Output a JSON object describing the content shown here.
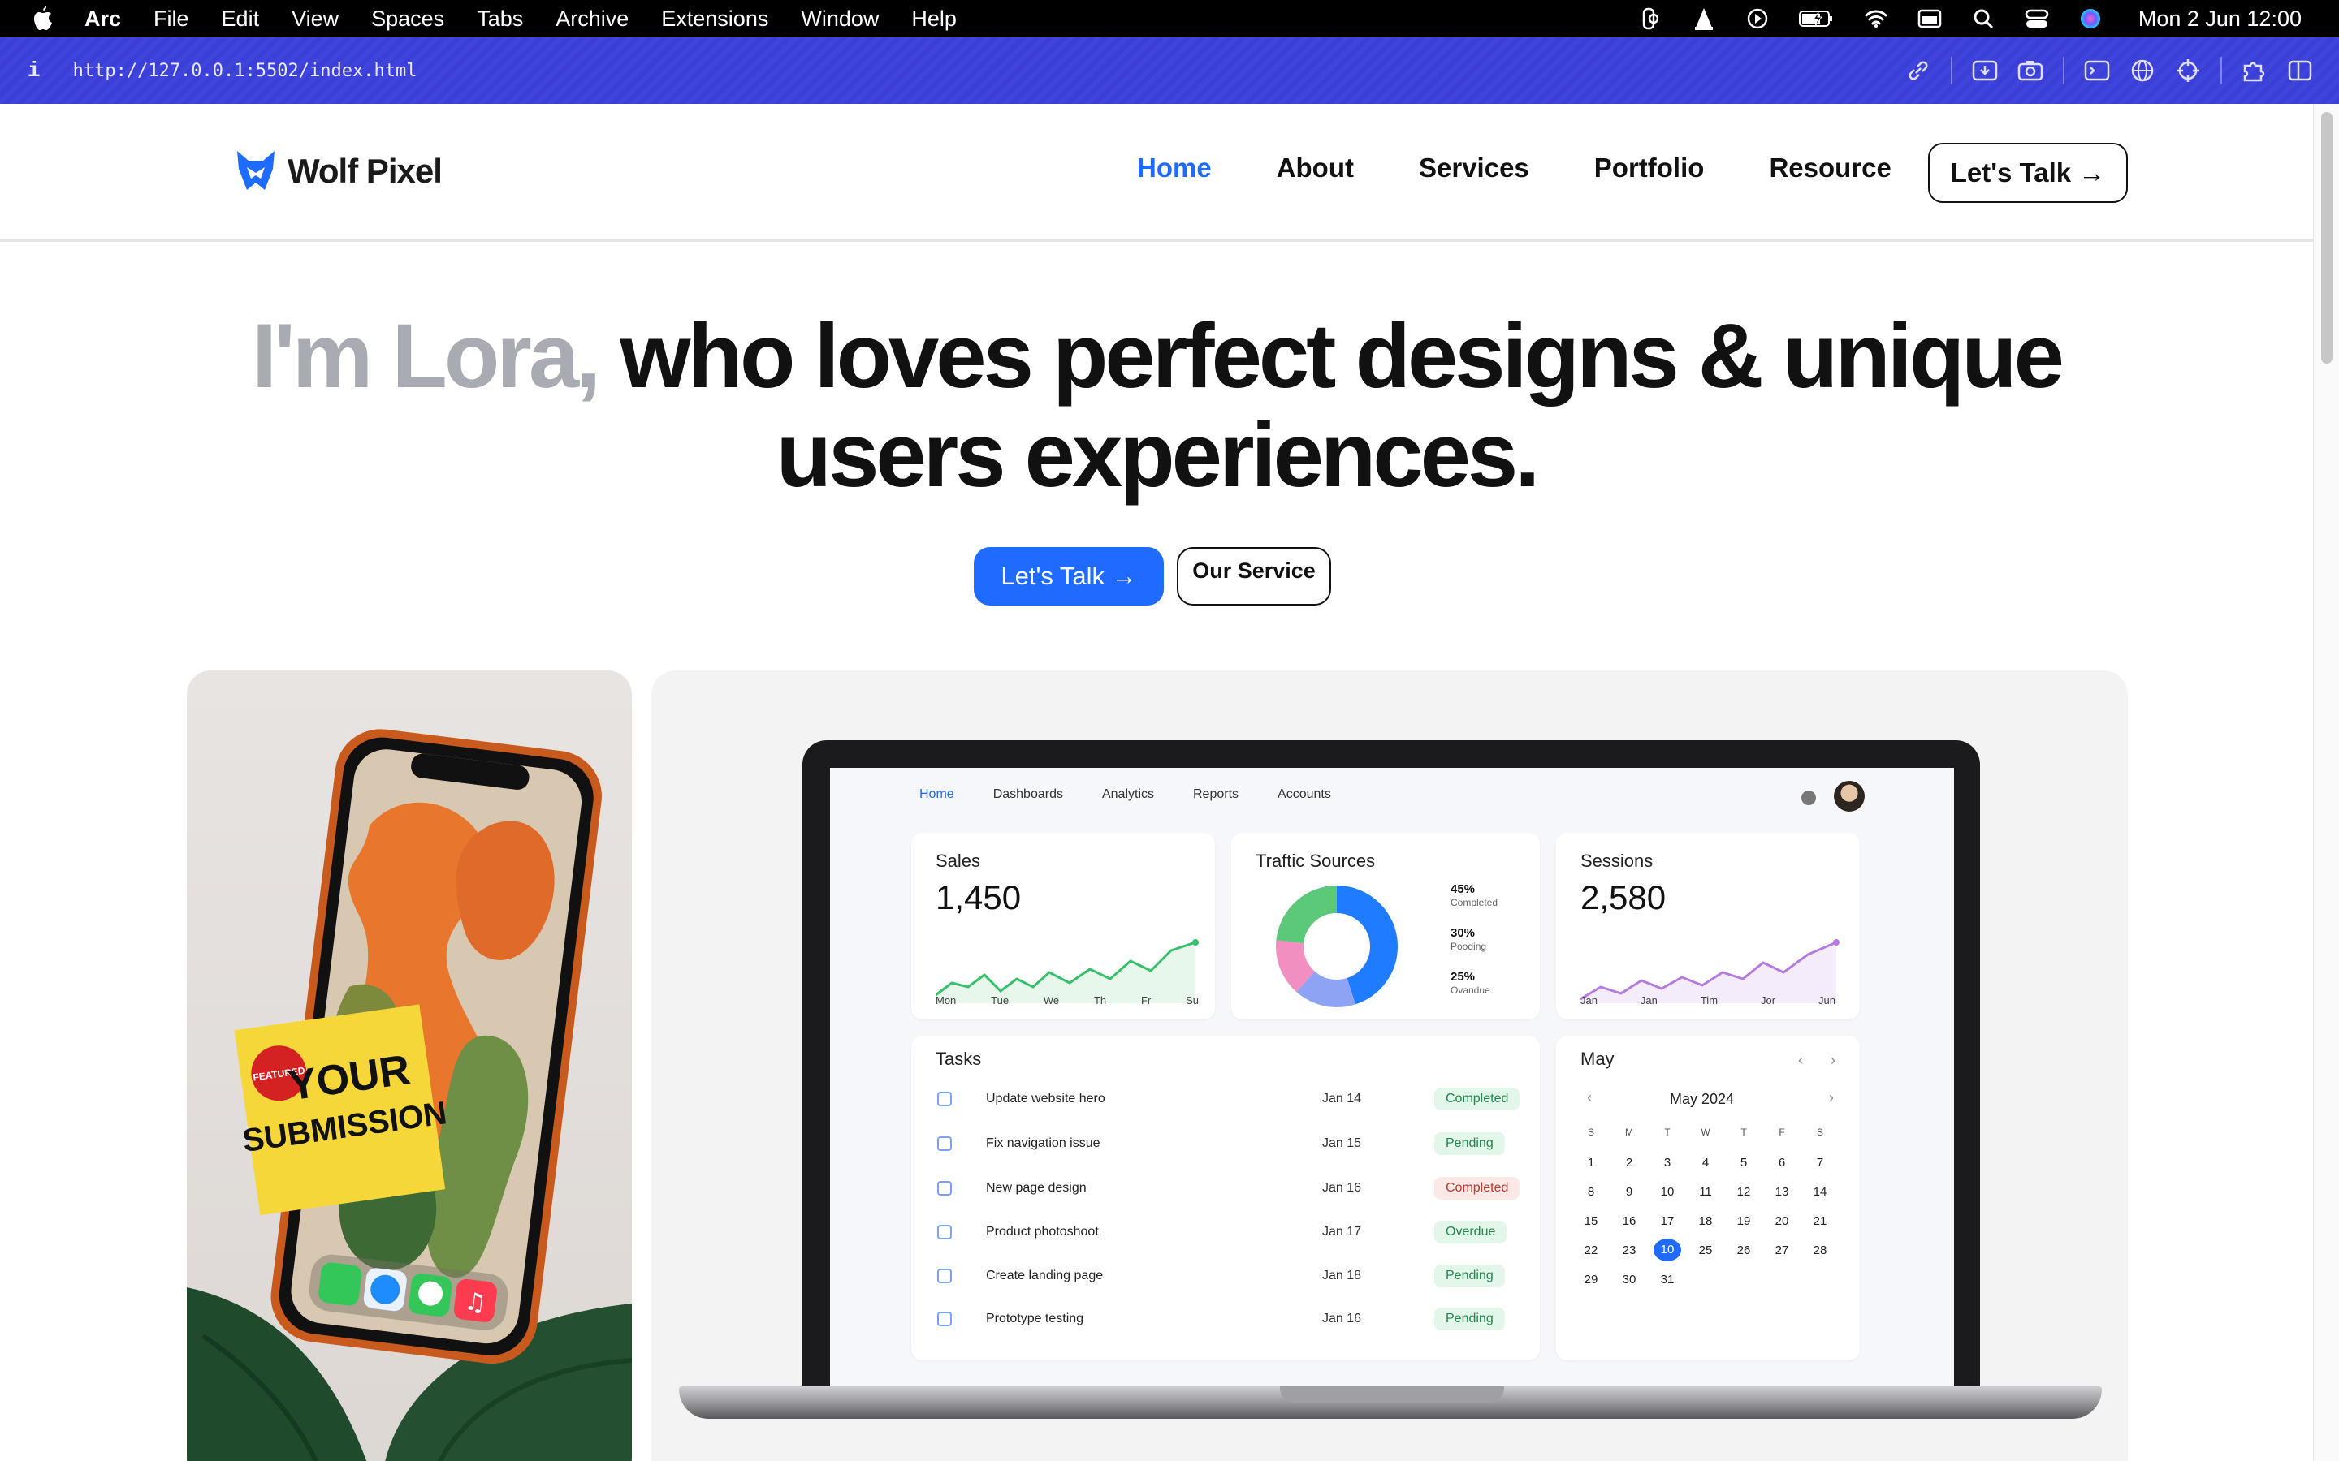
{
  "menubar": {
    "app": "Arc",
    "items": [
      "File",
      "Edit",
      "View",
      "Spaces",
      "Tabs",
      "Archive",
      "Extensions",
      "Window",
      "Help"
    ],
    "clock": "Mon 2 Jun  12:00",
    "icons": [
      "figma-icon",
      "vlc-icon",
      "play-icon",
      "battery-icon",
      "wifi-icon",
      "calendar-icon",
      "search-icon",
      "control-center-icon",
      "siri-icon"
    ]
  },
  "browser": {
    "url": "http://127.0.0.1:5502/index.html",
    "info": "i",
    "tools": [
      "link-icon",
      "download-icon",
      "camera-icon",
      "terminal-icon",
      "globe-icon",
      "crosshair-icon",
      "extensions-icon",
      "sidebar-icon"
    ]
  },
  "site": {
    "brand": "Wolf Pixel",
    "nav": [
      "Home",
      "About",
      "Services",
      "Portfolio",
      "Resource"
    ],
    "nav_active": "Home",
    "nav_cta": "Let's Talk →",
    "hero_gray": "I'm Lora, ",
    "hero_rest_line1": "who loves perfect designs & unique",
    "hero_line2": "users experiences.",
    "cta_primary": "Let's Talk →",
    "cta_secondary": "Our Service",
    "accent": "#1f6bff"
  },
  "mockup": {
    "sticker_badge": "FEATURED",
    "sticker_line1": "YOUR",
    "sticker_line2": "SUBMISSION"
  },
  "dashboard": {
    "nav": [
      "Home",
      "Dashboards",
      "Analytics",
      "Reports",
      "Accounts"
    ],
    "sales": {
      "title": "Sales",
      "value": "1,450",
      "axis": [
        "Mon",
        "Tue",
        "We",
        "Th",
        "Fr",
        "Su"
      ]
    },
    "traffic": {
      "title": "Traftic Sources",
      "items": [
        {
          "pct": "45%",
          "label": "Completed"
        },
        {
          "pct": "30%",
          "label": "Pooding"
        },
        {
          "pct": "25%",
          "label": "Ovandue"
        }
      ]
    },
    "sessions": {
      "title": "Sessions",
      "value": "2,580",
      "axis": [
        "Jan",
        "Jan",
        "Tim",
        "Jor",
        "Jun"
      ]
    },
    "tasks": {
      "title": "Tasks",
      "rows": [
        {
          "name": "Update website hero",
          "date": "Jan 14",
          "status": "Completed",
          "tone": "green"
        },
        {
          "name": "Fix navigation issue",
          "date": "Jan 15",
          "status": "Pending",
          "tone": "green"
        },
        {
          "name": "New page design",
          "date": "Jan 16",
          "status": "Completed",
          "tone": "red"
        },
        {
          "name": "Product photoshoot",
          "date": "Jan 17",
          "status": "Overdue",
          "tone": "green"
        },
        {
          "name": "Create landing page",
          "date": "Jan 18",
          "status": "Pending",
          "tone": "green"
        },
        {
          "name": "Prototype testing",
          "date": "Jan 16",
          "status": "Pending",
          "tone": "green"
        }
      ]
    },
    "calendar": {
      "title": "May",
      "month": "May 2024",
      "weekdays": [
        "S",
        "M",
        "T",
        "W",
        "T",
        "F",
        "S"
      ],
      "weeks": [
        [
          "1",
          "2",
          "3",
          "4",
          "5",
          "6",
          "7"
        ],
        [
          "8",
          "9",
          "10",
          "11",
          "12",
          "13",
          "14"
        ],
        [
          "15",
          "16",
          "17",
          "18",
          "19",
          "20",
          "21"
        ],
        [
          "22",
          "23",
          "10",
          "25",
          "26",
          "27",
          "28"
        ],
        [
          "29",
          "30",
          "31"
        ]
      ],
      "selected": "10"
    }
  }
}
